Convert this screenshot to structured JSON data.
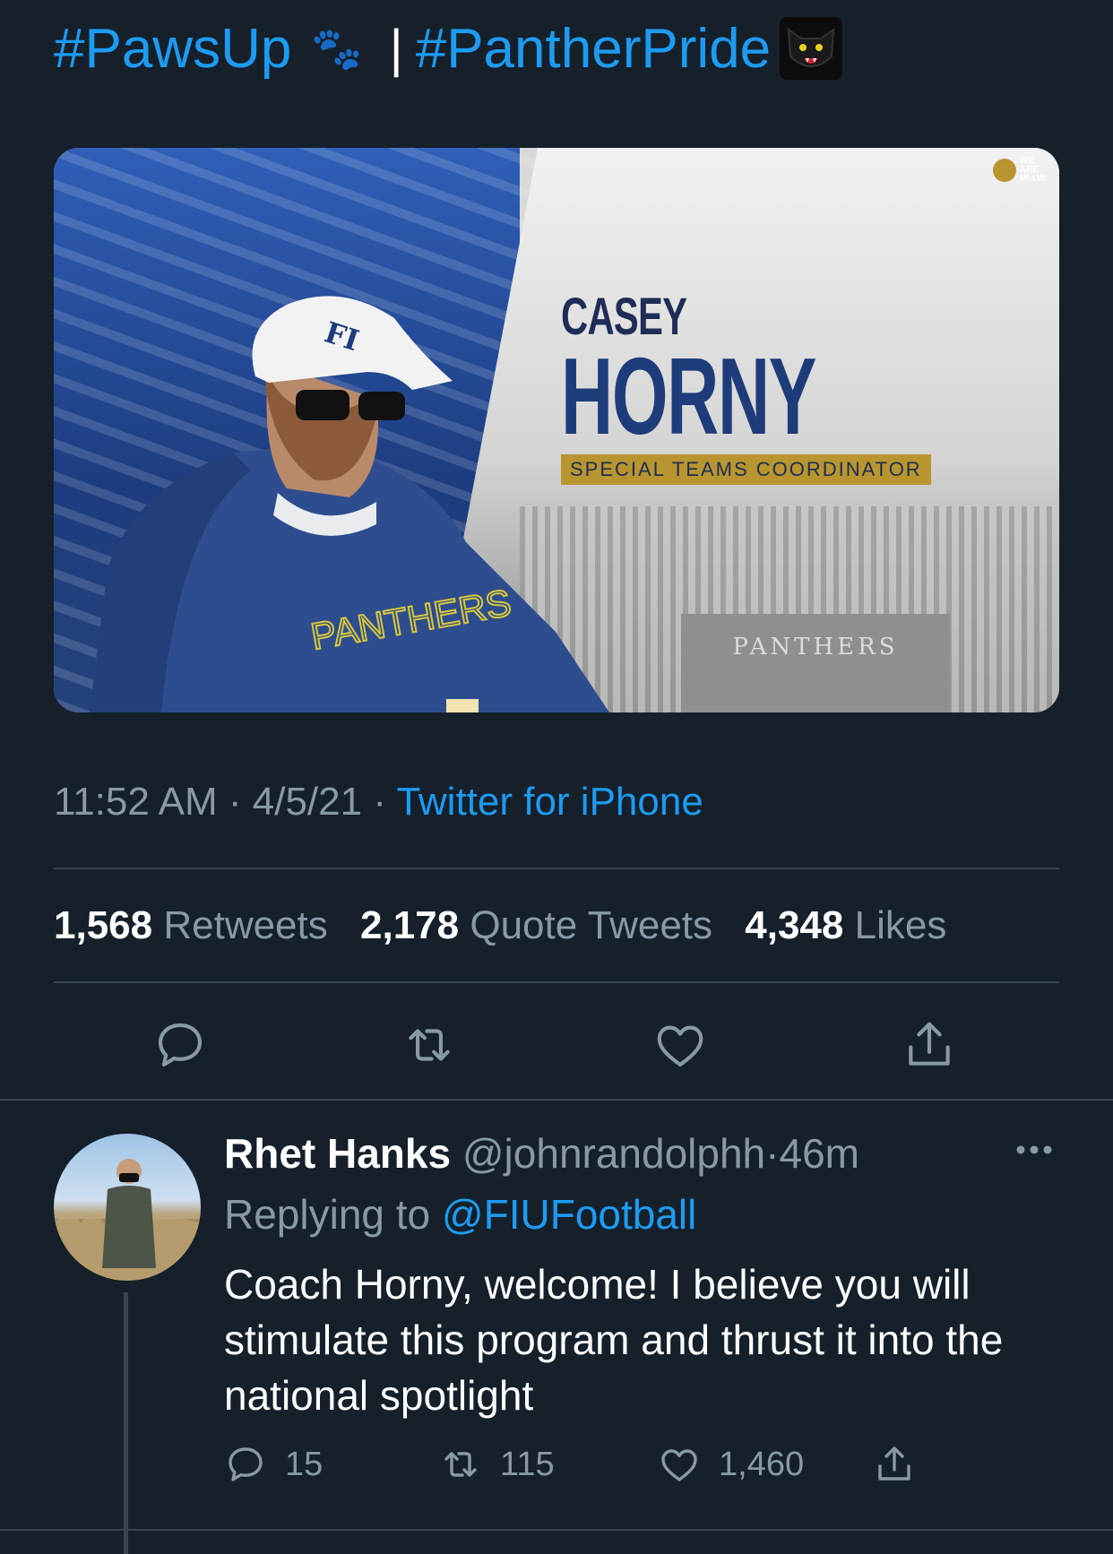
{
  "header": {
    "hashtag_1": "#PawsUp",
    "separator": "|",
    "hashtag_2": "#PantherPride"
  },
  "media": {
    "first_name": "CASEY",
    "last_name": "HORNY",
    "role": "SPECIAL TEAMS COORDINATOR",
    "sweatshirt_text": "PANTHERS",
    "field_text": "PANTHERS",
    "brand_line1": "WE",
    "brand_line2": "ARE",
    "brand_line3": "MIAMI."
  },
  "tweet_meta": {
    "time": "11:52 AM",
    "date": "4/5/21",
    "source": "Twitter for iPhone"
  },
  "stats": {
    "retweets_count": "1,568",
    "retweets_label": "Retweets",
    "quotes_count": "2,178",
    "quotes_label": "Quote Tweets",
    "likes_count": "4,348",
    "likes_label": "Likes"
  },
  "reply": {
    "name": "Rhet Hanks",
    "handle": "@johnrandolphh",
    "time": "46m",
    "replying_prefix": "Replying to",
    "replying_to": "@FIUFootball",
    "text": "Coach Horny, welcome! I believe you will stimulate this program and thrust it into the national spotlight",
    "reply_count": "15",
    "retweet_count": "115",
    "like_count": "1,460"
  },
  "colors": {
    "background": "#15202b",
    "accent": "#1d9bf0",
    "muted": "#8899a6",
    "divider": "#38444d"
  },
  "icons": [
    "paw-prints-icon",
    "panther-emoji-icon",
    "reply-icon",
    "retweet-icon",
    "like-icon",
    "share-icon",
    "more-icon"
  ]
}
